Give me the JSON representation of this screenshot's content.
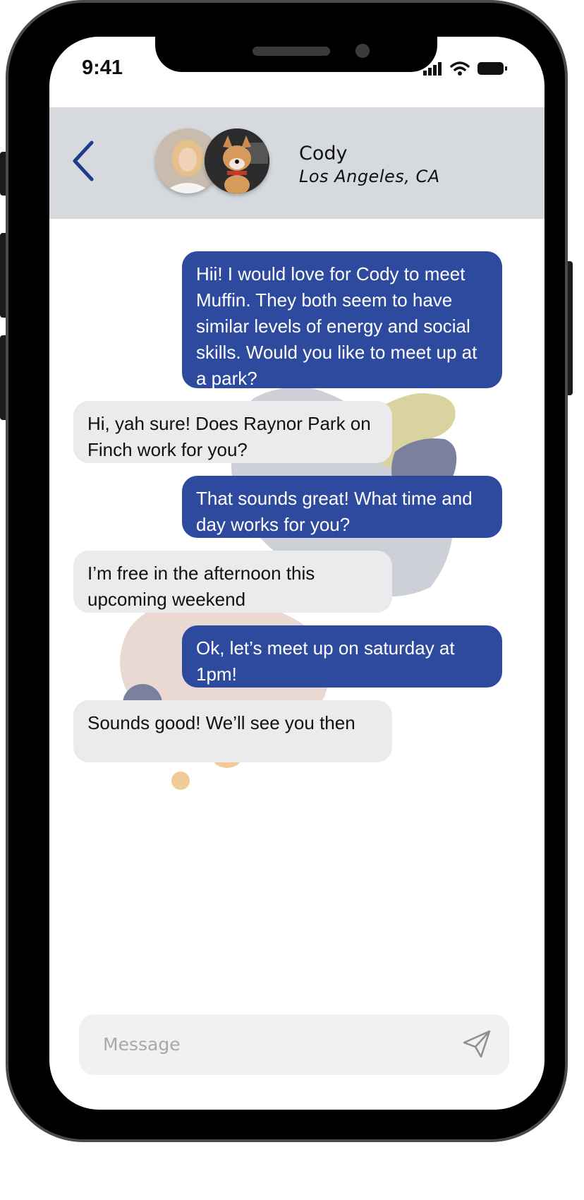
{
  "status_bar": {
    "time": "9:41"
  },
  "header": {
    "contact_name": "Cody",
    "contact_location": "Los Angeles, CA"
  },
  "messages": [
    {
      "direction": "sent",
      "text": "Hii! I would love for Cody to meet Muffin. They both seem to have similar levels of energy and social skills. Would you like to meet up at a park?"
    },
    {
      "direction": "received",
      "text": "Hi, yah sure! Does Raynor Park on Finch work for you?"
    },
    {
      "direction": "sent",
      "text": "That sounds great! What time and day works for you?"
    },
    {
      "direction": "received",
      "text": "I’m free in the afternoon this upcoming weekend"
    },
    {
      "direction": "sent",
      "text": "Ok, let’s meet up on saturday at 1pm!"
    },
    {
      "direction": "received",
      "text": "Sounds good! We’ll see you then"
    }
  ],
  "composer": {
    "placeholder": "Message"
  },
  "colors": {
    "sent_bubble": "#2e4a9e",
    "received_bubble": "#ebebed",
    "header_bg": "#d6d9dd",
    "back_icon": "#1f3c88"
  },
  "icons": [
    "back-chevron-icon",
    "signal-icon",
    "wifi-icon",
    "battery-icon",
    "send-paper-plane-icon"
  ]
}
